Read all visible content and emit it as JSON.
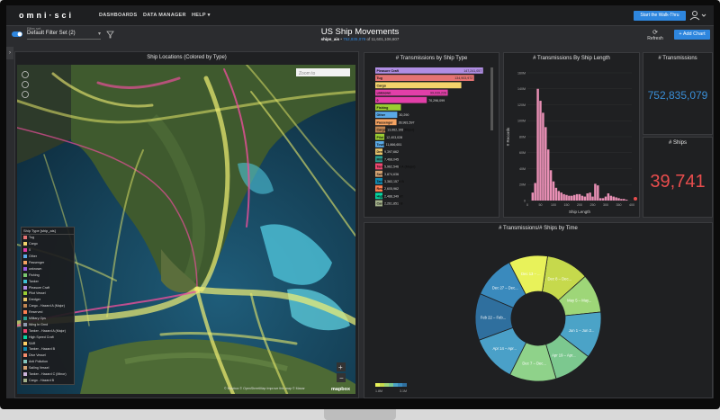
{
  "header": {
    "logo": "omni·sci",
    "nav": [
      "DASHBOARDS",
      "DATA MANAGER",
      "HELP ▾"
    ],
    "tour_button": "Start the Walk-Thru",
    "user_icon": "user-icon"
  },
  "toolbar": {
    "filter_label": "Filter set",
    "filter_value": "Default Filter Set (2)",
    "dashboard_title": "US Ship Movements",
    "table_name": "ships_ais",
    "filtered_count": "752,835,079",
    "total_count": "11,601,106,607",
    "refresh_label": "Refresh",
    "add_chart_label": "+ Add Chart"
  },
  "map": {
    "title": "Ship Locations (Colored by Type)",
    "zoom_placeholder": "Zoom to",
    "legend_title": "Ship Type [ship_ais]",
    "legend_items": [
      {
        "label": "Tug",
        "color": "#e57373"
      },
      {
        "label": "Cargo",
        "color": "#f3d36b"
      },
      {
        "label": "0",
        "color": "#e23fa8"
      },
      {
        "label": "Other",
        "color": "#5aa9e6"
      },
      {
        "label": "Passenger",
        "color": "#f4a261"
      },
      {
        "label": "unknown",
        "color": "#9b5de5"
      },
      {
        "label": "Fishing",
        "color": "#7bc96f"
      },
      {
        "label": "Tanker",
        "color": "#3ec1d3"
      },
      {
        "label": "Pleasure Craft",
        "color": "#b08ee3"
      },
      {
        "label": "Pilot Vessel",
        "color": "#9acd32"
      },
      {
        "label": "Dredger",
        "color": "#e9c46a"
      },
      {
        "label": "Cargo - Hazard A (Major)",
        "color": "#c08552"
      },
      {
        "label": "Reserved",
        "color": "#ff7f50"
      },
      {
        "label": "Military Ops",
        "color": "#2a9d8f"
      },
      {
        "label": "Wing In Grnd",
        "color": "#8d99ae"
      },
      {
        "label": "Tanker - Hazard A (Major)",
        "color": "#ef476f"
      },
      {
        "label": "High Speed Craft",
        "color": "#06d6a0"
      },
      {
        "label": "SAR",
        "color": "#ffd166"
      },
      {
        "label": "Tanker - Hazard B",
        "color": "#118ab2"
      },
      {
        "label": "Dive Vessel",
        "color": "#f78c6b"
      },
      {
        "label": "Anti Pollution",
        "color": "#83c5be"
      },
      {
        "label": "Sailing Vessel",
        "color": "#d4a373"
      },
      {
        "label": "Tanker - Hazard C (Minor)",
        "color": "#cdb4db"
      },
      {
        "label": "Cargo - Hazard B",
        "color": "#a3b18a"
      }
    ],
    "attribution": "© Mapbox  © OpenStreetMap  Improve this map  © Maxar",
    "mapbox_logo": "mapbox"
  },
  "charts": {
    "type_bar_title": "# Transmissions by Ship Type",
    "histogram_title": "# Transmissions By Ship Length",
    "histogram_xlabel": "Ship Length",
    "histogram_ylabel": "# Records",
    "kpi_transmissions_title": "# Transmissions",
    "kpi_transmissions_value": "752,835,079",
    "kpi_ships_title": "# Ships",
    "kpi_ships_value": "39,741",
    "donut_title": "# Transmissions/# Ships by Time",
    "donut_legend_min": "1.8M",
    "donut_legend_max": "3.1M"
  },
  "chart_data": [
    {
      "type": "bar",
      "title": "# Transmissions by Ship Type",
      "orientation": "horizontal",
      "categories": [
        "Pleasure Craft",
        "Tug",
        "Cargo",
        "unknown",
        "0",
        "Fishing",
        "Other",
        "Passenger",
        "Cargo - Hazard A (Major)",
        "Pilot Vessel",
        "Towing",
        "Dredger",
        "Military Ops",
        "Tanker - Hazard A (Major)",
        "Sailing Vessel",
        "Tanker - Hazard B",
        "Reserved",
        "High Speed Craft",
        "Cargo - Hazard B"
      ],
      "labels": [
        "147,241,057",
        "134,903,972",
        "",
        "99,039,226",
        "70,296,099",
        "",
        "30,290",
        "28,981,597",
        "13,662,106",
        "12,403,028",
        "11,866,651",
        "9,397,662",
        "7,468,045",
        "5,962,546",
        "3,874,636",
        "3,383,157",
        "2,605,962",
        "2,488,349",
        "2,261,851"
      ],
      "values": [
        147241057,
        134903972,
        117500000,
        99039226,
        70296099,
        35000000,
        30000000,
        28981597,
        13662106,
        12403028,
        11866651,
        9397662,
        7468045,
        5962546,
        3874636,
        3383157,
        2605962,
        2488349,
        2261851
      ],
      "colors": [
        "#b08ee3",
        "#e57373",
        "#f3d36b",
        "#e23fa8",
        "#e23fa8",
        "#9acd32",
        "#5aa9e6",
        "#f4a261",
        "#c08552",
        "#9acd32",
        "#5aa9e6",
        "#e9c46a",
        "#2a9d8f",
        "#ef476f",
        "#d4a373",
        "#118ab2",
        "#ff7f50",
        "#06d6a0",
        "#a3b18a"
      ],
      "xlim": [
        0,
        150000000
      ]
    },
    {
      "type": "bar",
      "title": "# Transmissions By Ship Length",
      "xlabel": "Ship Length",
      "ylabel": "# Records",
      "x_ticks": [
        "0",
        "50",
        "100",
        "150",
        "200",
        "250",
        "300",
        "350",
        "400"
      ],
      "y_ticks": [
        "0",
        "20M",
        "40M",
        "60M",
        "80M",
        "100M",
        "120M",
        "140M",
        "160M"
      ],
      "ylim": [
        0,
        160000000
      ],
      "xlim": [
        0,
        400
      ],
      "x": [
        20,
        30,
        40,
        50,
        60,
        70,
        80,
        90,
        100,
        110,
        120,
        130,
        140,
        150,
        160,
        170,
        180,
        190,
        200,
        210,
        220,
        230,
        240,
        250,
        260,
        270,
        280,
        290,
        300,
        310,
        320,
        330,
        340,
        350,
        360,
        370,
        380
      ],
      "values": [
        10000000,
        22000000,
        140000000,
        125000000,
        110000000,
        92000000,
        64000000,
        38000000,
        24000000,
        16000000,
        12000000,
        10000000,
        8000000,
        7000000,
        6000000,
        6000000,
        7000000,
        8000000,
        8000000,
        6000000,
        5000000,
        9000000,
        10000000,
        5000000,
        21000000,
        19000000,
        3000000,
        3000000,
        5000000,
        9000000,
        6000000,
        5000000,
        4000000,
        3000000,
        2000000,
        2000000,
        1000000
      ]
    },
    {
      "type": "pie",
      "title": "# Transmissions/# Ships by Time",
      "donut": true,
      "labels": [
        "Dec 8 – Dec...",
        "May 5 – May...",
        "Jun 1 – Jun 2...",
        "Apr 19 – Apr...",
        "Dec 7 – Dec...",
        "Apr 14 – Apr...",
        "Feb 22 – Feb...",
        "Dec 27 – Dec...",
        "Dec 13 – ..."
      ],
      "values": [
        11,
        10,
        12,
        10,
        12,
        12,
        12,
        11,
        10
      ],
      "colors": [
        "#c6d94c",
        "#9ed678",
        "#4ba3c7",
        "#7cc88f",
        "#8fd28a",
        "#4aa0c8",
        "#2f6f9e",
        "#3a8abd",
        "#e8f25a"
      ],
      "legend_range": [
        "1.8M",
        "3.1M"
      ]
    }
  ]
}
